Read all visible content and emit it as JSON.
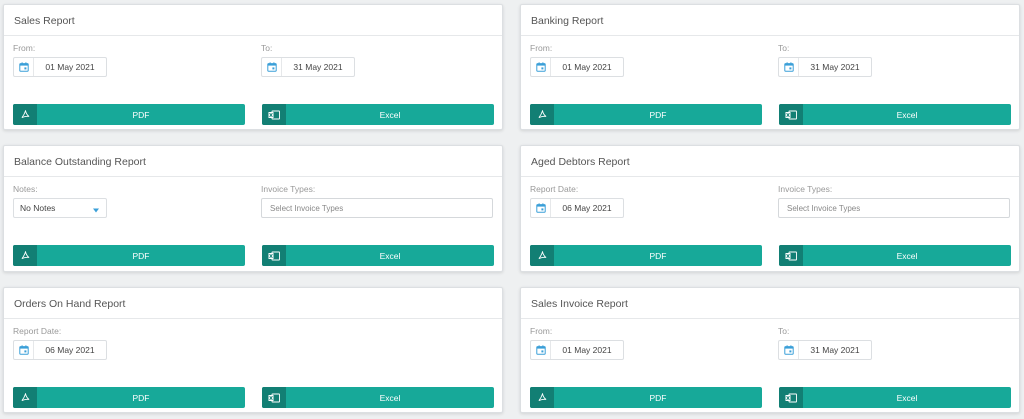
{
  "cards": {
    "sales": {
      "title": "Sales Report",
      "from_label": "From:",
      "from_value": "01 May 2021",
      "to_label": "To:",
      "to_value": "31 May 2021",
      "pdf_label": "PDF",
      "excel_label": "Excel"
    },
    "banking": {
      "title": "Banking Report",
      "from_label": "From:",
      "from_value": "01 May 2021",
      "to_label": "To:",
      "to_value": "31 May 2021",
      "pdf_label": "PDF",
      "excel_label": "Excel"
    },
    "balance": {
      "title": "Balance Outstanding Report",
      "notes_label": "Notes:",
      "notes_value": "No Notes",
      "invoice_types_label": "Invoice Types:",
      "invoice_types_placeholder": "Select Invoice Types",
      "pdf_label": "PDF",
      "excel_label": "Excel"
    },
    "aged": {
      "title": "Aged Debtors Report",
      "report_date_label": "Report Date:",
      "report_date_value": "06 May 2021",
      "invoice_types_label": "Invoice Types:",
      "invoice_types_placeholder": "Select Invoice Types",
      "pdf_label": "PDF",
      "excel_label": "Excel"
    },
    "orders": {
      "title": "Orders On Hand Report",
      "report_date_label": "Report Date:",
      "report_date_value": "06 May 2021",
      "pdf_label": "PDF",
      "excel_label": "Excel"
    },
    "sales_invoice": {
      "title": "Sales Invoice Report",
      "from_label": "From:",
      "from_value": "01 May 2021",
      "to_label": "To:",
      "to_value": "31 May 2021",
      "pdf_label": "PDF",
      "excel_label": "Excel"
    }
  },
  "icons": {
    "calendar": "calendar-icon",
    "pdf": "pdf-icon",
    "excel": "excel-icon",
    "caret": "chevron-down-icon"
  },
  "colors": {
    "accent": "#17a999",
    "accent_dark": "#127f74",
    "calendar_icon": "#3a9fd8"
  }
}
